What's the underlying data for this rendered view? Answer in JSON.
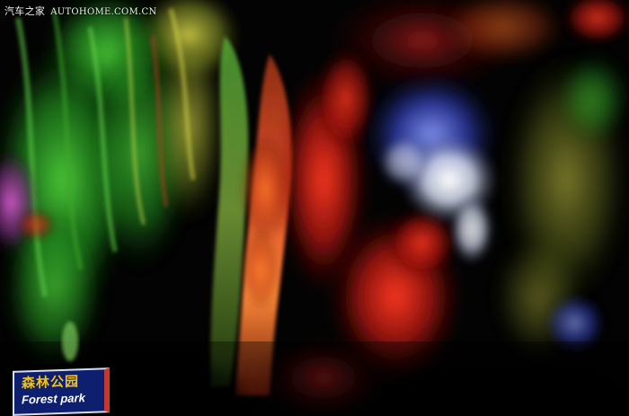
{
  "watermark": {
    "brand": "汽车之家",
    "site": "AUTOHOME.COM.CN"
  },
  "sign": {
    "chinese": "森林公园",
    "english": "Forest park",
    "background_color": "#0d1f6e",
    "text_color": "#f0c21b"
  },
  "palette": {
    "green": "#3fbf2a",
    "yellow_green": "#b8c83a",
    "red": "#e0281c",
    "blue": "#3a4fd0",
    "purple": "#b04aa8",
    "white": "#e8ecf4"
  }
}
